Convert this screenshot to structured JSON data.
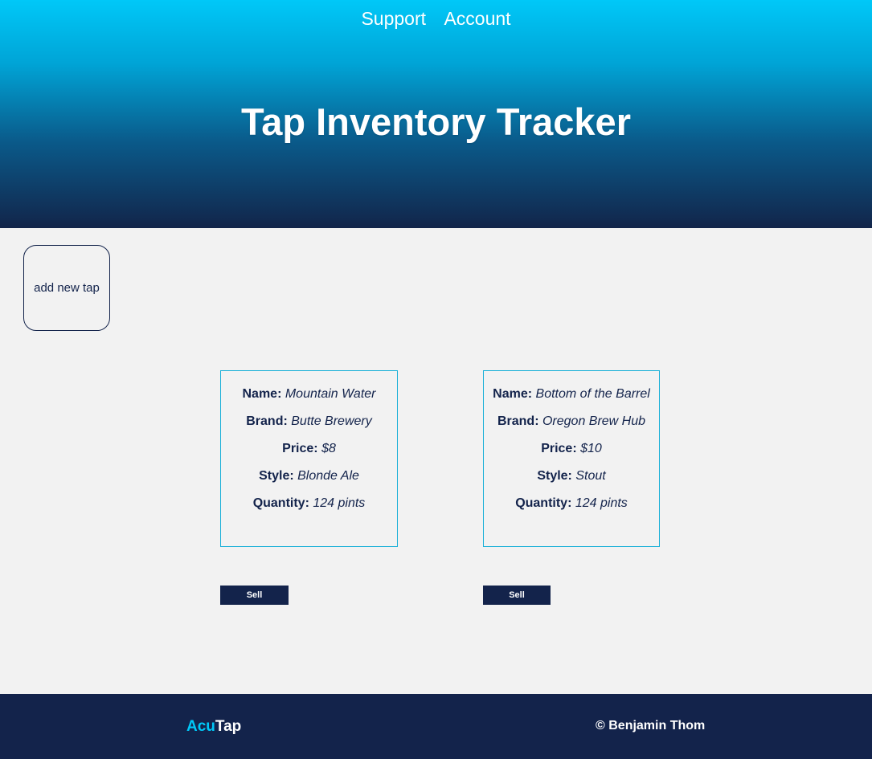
{
  "nav": {
    "items": [
      {
        "label": "Support"
      },
      {
        "label": "Account"
      }
    ]
  },
  "header": {
    "title": "Tap Inventory Tracker"
  },
  "actions": {
    "add_label": "add new tap"
  },
  "field_labels": {
    "name": "Name:",
    "brand": "Brand:",
    "price": "Price:",
    "style": "Style:",
    "quantity": "Quantity:"
  },
  "taps": [
    {
      "name": "Mountain Water",
      "brand": "Butte Brewery",
      "price": "$8",
      "style": "Blonde Ale",
      "quantity": "124 pints",
      "sell_label": "Sell"
    },
    {
      "name": "Bottom of the Barrel",
      "brand": "Oregon Brew Hub",
      "price": "$10",
      "style": "Stout",
      "quantity": "124 pints",
      "sell_label": "Sell"
    }
  ],
  "footer": {
    "logo_part1": "Acu",
    "logo_part2": "Tap",
    "copyright": "© Benjamin Thom"
  },
  "colors": {
    "navy": "#13234b",
    "cyan": "#00c8f8",
    "card_border": "#1ab0d8",
    "background": "#f2f2f2"
  }
}
